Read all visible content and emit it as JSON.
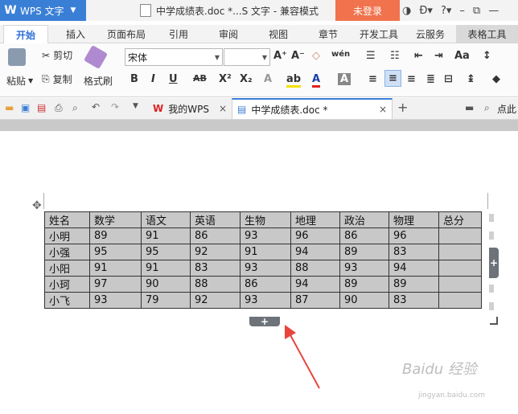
{
  "titlebar": {
    "app_name": "WPS 文字",
    "doc_title": "中学成绩表.doc *...S 文字 - 兼容模式",
    "login_button": "未登录"
  },
  "menu": {
    "tabs": [
      "开始",
      "插入",
      "页面布局",
      "引用",
      "审阅",
      "视图",
      "章节",
      "开发工具",
      "云服务",
      "表格工具"
    ],
    "active_tab": "开始"
  },
  "ribbon": {
    "paste_label": "粘贴",
    "cut_label": "剪切",
    "copy_label": "复制",
    "format_painter_label": "格式刷",
    "font_name": "宋体",
    "font_size": ""
  },
  "doc_tabs": {
    "tab1": "我的WPS",
    "tab2": "中学成绩表.doc *",
    "search_label": "点此"
  },
  "table": {
    "headers": [
      "姓名",
      "数学",
      "语文",
      "英语",
      "生物",
      "地理",
      "政治",
      "物理",
      "总分"
    ],
    "rows": [
      [
        "小明",
        "89",
        "91",
        "86",
        "93",
        "96",
        "86",
        "96",
        ""
      ],
      [
        "小强",
        "95",
        "95",
        "92",
        "91",
        "94",
        "89",
        "83",
        ""
      ],
      [
        "小阳",
        "91",
        "91",
        "83",
        "93",
        "88",
        "93",
        "94",
        ""
      ],
      [
        "小珂",
        "97",
        "90",
        "88",
        "86",
        "94",
        "89",
        "89",
        ""
      ],
      [
        "小飞",
        "93",
        "79",
        "92",
        "93",
        "87",
        "90",
        "83",
        ""
      ]
    ]
  },
  "controls": {
    "add_row_symbol": "+",
    "add_col_symbol": "+"
  },
  "watermark": {
    "text": "Baidu 经验",
    "sub": "jingyan.baidu.com"
  },
  "colors": {
    "accent": "#3a7fd6",
    "login": "#f0734e",
    "table_fill": "#c8c8c8",
    "arrow": "#e8453c"
  }
}
